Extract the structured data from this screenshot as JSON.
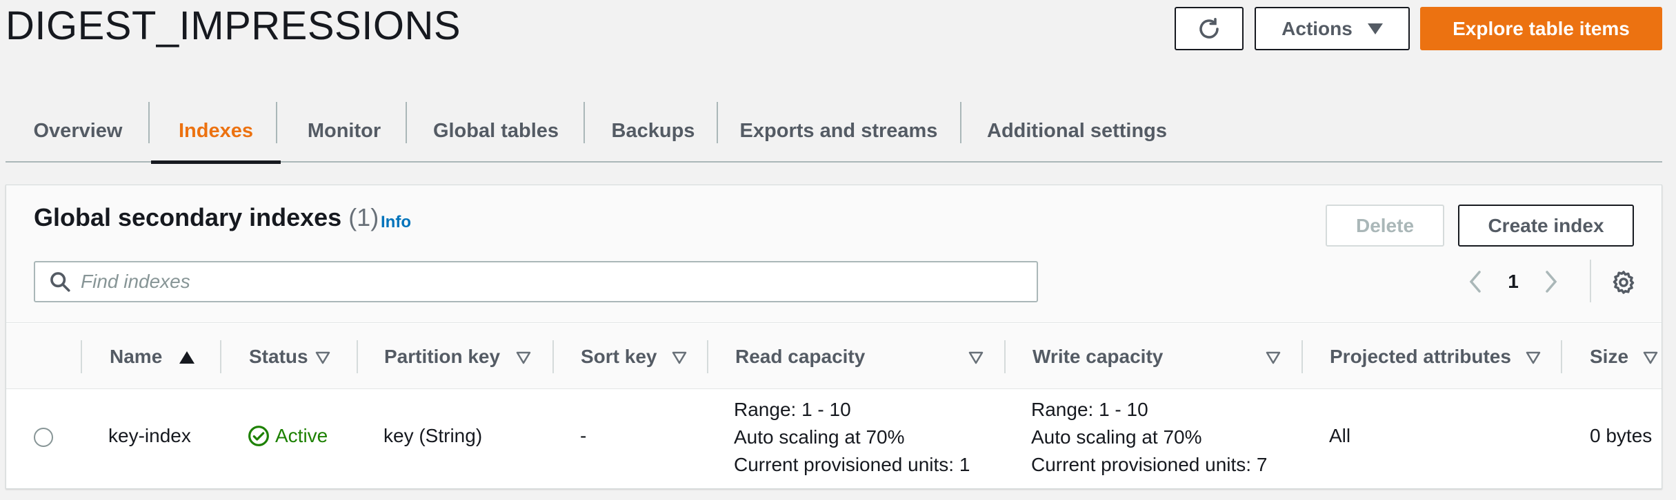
{
  "header": {
    "title": "DIGEST_IMPRESSIONS",
    "actions_label": "Actions",
    "explore_label": "Explore table items"
  },
  "tabs": [
    {
      "label": "Overview"
    },
    {
      "label": "Indexes"
    },
    {
      "label": "Monitor"
    },
    {
      "label": "Global tables"
    },
    {
      "label": "Backups"
    },
    {
      "label": "Exports and streams"
    },
    {
      "label": "Additional settings"
    }
  ],
  "active_tab": "Indexes",
  "panel": {
    "title": "Global secondary indexes",
    "count": "(1)",
    "info_label": "Info",
    "delete_label": "Delete",
    "create_label": "Create index",
    "search_placeholder": "Find indexes",
    "page": "1"
  },
  "columns": [
    {
      "label": "Name"
    },
    {
      "label": "Status"
    },
    {
      "label": "Partition key"
    },
    {
      "label": "Sort key"
    },
    {
      "label": "Read capacity"
    },
    {
      "label": "Write capacity"
    },
    {
      "label": "Projected attributes"
    },
    {
      "label": "Size"
    }
  ],
  "rows": [
    {
      "name": "key-index",
      "status": "Active",
      "partition_key": "key (String)",
      "sort_key": "-",
      "read_capacity": [
        "Range: 1 - 10",
        "Auto scaling at 70%",
        "Current provisioned units: 1"
      ],
      "write_capacity": [
        "Range: 1 - 10",
        "Auto scaling at 70%",
        "Current provisioned units: 7"
      ],
      "projected_attributes": "All",
      "size": "0 bytes"
    }
  ],
  "colors": {
    "accent": "#ec7211",
    "link": "#0073bb",
    "success": "#1d8102"
  }
}
